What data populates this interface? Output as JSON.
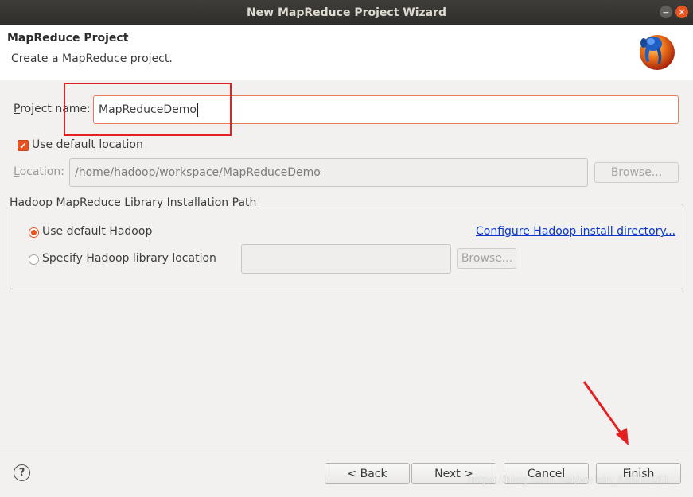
{
  "window": {
    "title": "New MapReduce Project Wizard",
    "minimize_glyph": "−",
    "close_glyph": "✕"
  },
  "header": {
    "title": "MapReduce Project",
    "description": "Create a MapReduce project."
  },
  "project_name": {
    "label_prefix": "P",
    "label_rest": "roject name:",
    "value": "MapReduceDemo"
  },
  "default_location": {
    "checkbox_label_prefix": "Use ",
    "checkbox_label_underline": "d",
    "checkbox_label_rest": "efault location",
    "checked": true,
    "checkmark": "✔"
  },
  "location": {
    "label_prefix": "L",
    "label_rest": "ocation:",
    "value": "/home/hadoop/workspace/MapReduceDemo",
    "browse_label": "Browse..."
  },
  "hadoop_group": {
    "title": "Hadoop MapReduce Library Installation Path",
    "option_default": "Use default Hadoop",
    "option_specify": "Specify Hadoop library location",
    "configure_link": "Configure Hadoop install directory...",
    "specify_path_value": "",
    "browse_label": "Browse..."
  },
  "footer": {
    "help_glyph": "?",
    "back_label": "< Back",
    "next_label": "Next >",
    "cancel_label": "Cancel",
    "finish_label": "Finish"
  },
  "watermark": "https://blog.csdn.net/weixin_43640161",
  "colors": {
    "accent": "#e95420",
    "annotation_red": "#e52020",
    "link": "#0b38c8"
  }
}
